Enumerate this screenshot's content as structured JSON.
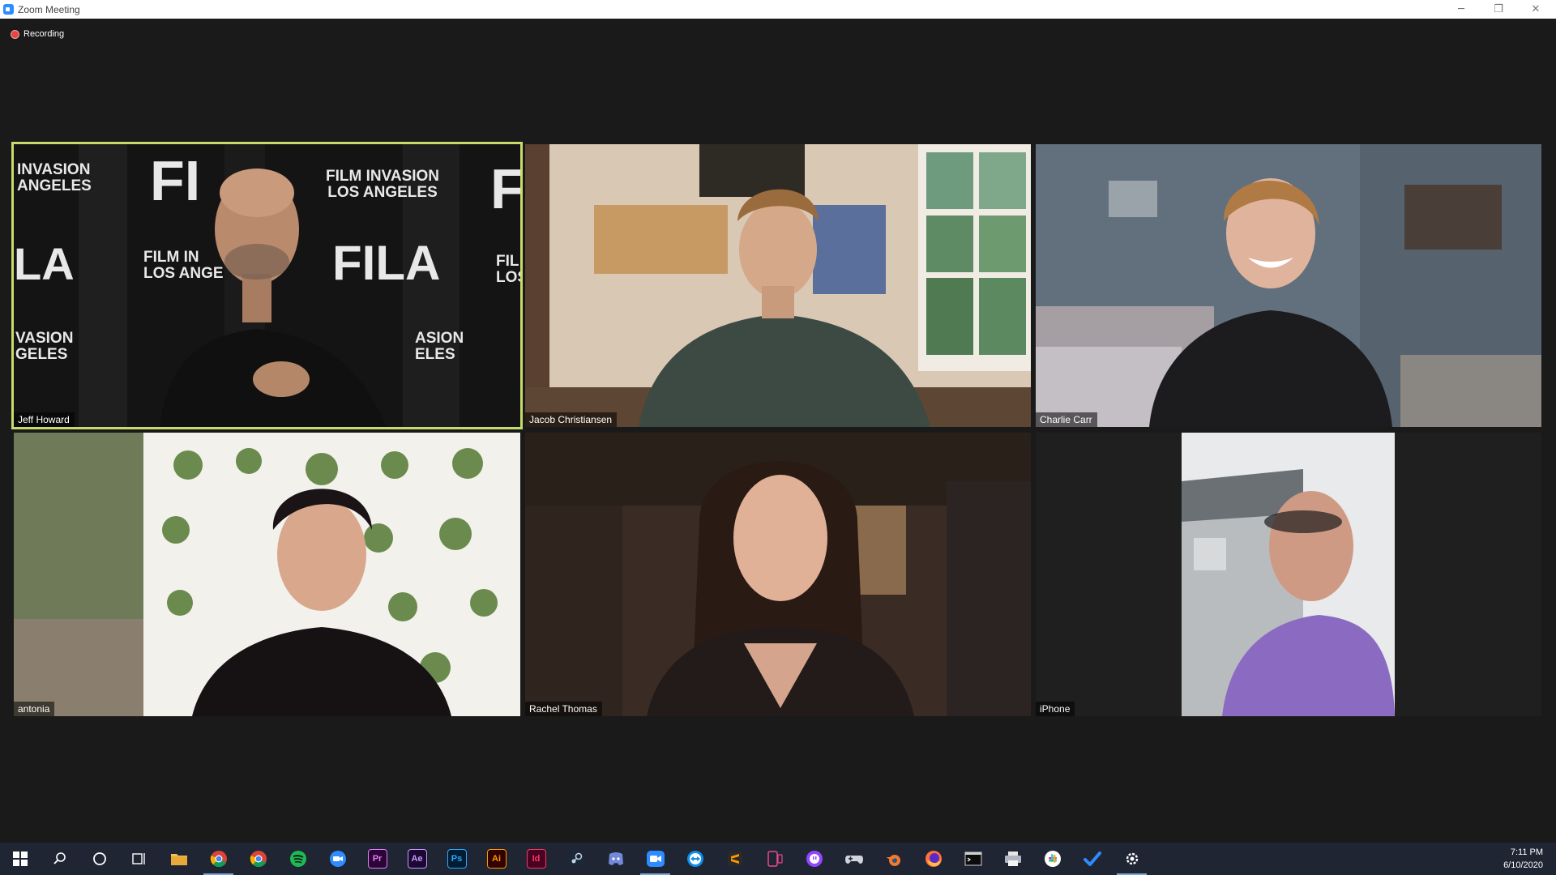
{
  "window": {
    "title": "Zoom Meeting",
    "controls": {
      "minimize": "─",
      "restore": "❐",
      "close": "✕"
    }
  },
  "recording": {
    "label": "Recording",
    "color": "#e84545"
  },
  "participants": [
    {
      "name": "Jeff Howard",
      "active_speaker": true
    },
    {
      "name": "Jacob Christiansen",
      "active_speaker": false
    },
    {
      "name": "Charlie Carr",
      "active_speaker": false
    },
    {
      "name": "antonia",
      "active_speaker": false
    },
    {
      "name": "Rachel Thomas",
      "active_speaker": false
    },
    {
      "name": "iPhone",
      "active_speaker": false
    }
  ],
  "backdrop": {
    "film_invasion": "FILM INVASION",
    "los_angeles": "LOS ANGELES",
    "fila": "FILA",
    "invasion": "INVASION",
    "angeles": "ANGELES",
    "fi": "FI",
    "la": "LA",
    "film_in": "FILM IN",
    "los_ange": "LOS ANGE",
    "vasion": "VASION",
    "geles": "GELES",
    "asion": "ASION",
    "eles": "ELES",
    "fil": "FIL",
    "los": "LOS"
  },
  "colors": {
    "active_speaker_border": "#c6dc6a",
    "zoom_blue": "#2D8CFF",
    "taskbar": "#1f2533"
  },
  "taskbar": {
    "apps": [
      {
        "icon": "windows-start-icon"
      },
      {
        "icon": "search-icon"
      },
      {
        "icon": "cortana-icon"
      },
      {
        "icon": "task-view-icon"
      },
      {
        "icon": "file-explorer-icon"
      },
      {
        "icon": "chrome-icon"
      },
      {
        "icon": "chrome-icon"
      },
      {
        "icon": "spotify-icon"
      },
      {
        "icon": "zoom-icon"
      },
      {
        "icon": "premiere-pro-icon",
        "text": "Pr"
      },
      {
        "icon": "after-effects-icon",
        "text": "Ae"
      },
      {
        "icon": "photoshop-icon",
        "text": "Ps"
      },
      {
        "icon": "illustrator-icon",
        "text": "Ai"
      },
      {
        "icon": "indesign-icon",
        "text": "Id"
      },
      {
        "icon": "steam-icon"
      },
      {
        "icon": "discord-icon"
      },
      {
        "icon": "zoom-video-icon"
      },
      {
        "icon": "teamviewer-icon"
      },
      {
        "icon": "sublime-text-icon"
      },
      {
        "icon": "phone-link-icon"
      },
      {
        "icon": "twitch-icon"
      },
      {
        "icon": "game-controller-icon"
      },
      {
        "icon": "blender-icon"
      },
      {
        "icon": "firefox-icon"
      },
      {
        "icon": "terminal-icon"
      },
      {
        "icon": "printer-icon"
      },
      {
        "icon": "slack-icon"
      },
      {
        "icon": "todo-check-icon"
      },
      {
        "icon": "settings-gear-icon"
      }
    ],
    "time": "7:11 PM",
    "date": "6/10/2020"
  }
}
